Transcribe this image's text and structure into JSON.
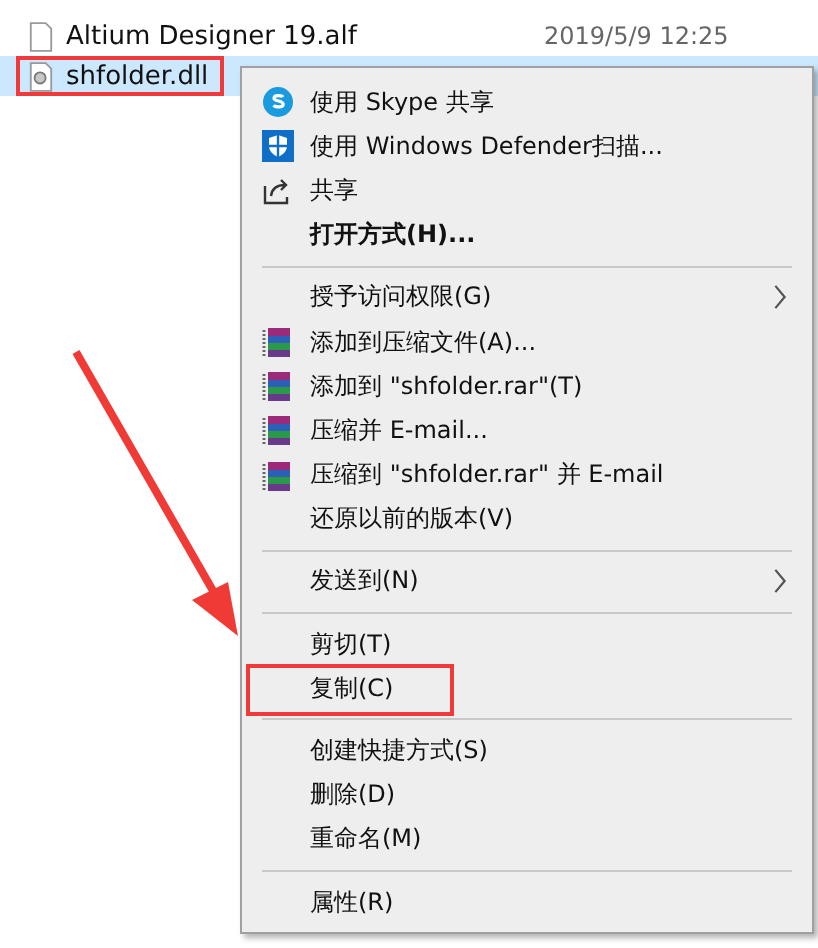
{
  "files": [
    {
      "name": "Altium Designer 19.alf",
      "date": "2019/5/9 12:25",
      "selected": false,
      "outlined": false,
      "kind": "document"
    },
    {
      "name": "shfolder.dll",
      "selected": true,
      "outlined": true,
      "kind": "dll"
    }
  ],
  "context_menu": {
    "items": [
      {
        "kind": "skype",
        "label": "使用 Skype 共享",
        "bold": false,
        "submenu": false,
        "outlined": false
      },
      {
        "kind": "defender",
        "label": "使用 Windows Defender扫描...",
        "bold": false,
        "submenu": false,
        "outlined": false
      },
      {
        "kind": "share",
        "label": "共享",
        "bold": false,
        "submenu": false,
        "outlined": false
      },
      {
        "kind": "plain",
        "label": "打开方式(H)...",
        "bold": true,
        "submenu": false,
        "outlined": false
      },
      {
        "kind": "separator"
      },
      {
        "kind": "plain",
        "label": "授予访问权限(G)",
        "bold": false,
        "submenu": true,
        "outlined": false
      },
      {
        "kind": "archive",
        "label": "添加到压缩文件(A)...",
        "bold": false,
        "submenu": false,
        "outlined": false
      },
      {
        "kind": "archive",
        "label": "添加到 \"shfolder.rar\"(T)",
        "bold": false,
        "submenu": false,
        "outlined": false
      },
      {
        "kind": "archive",
        "label": "压缩并 E-mail...",
        "bold": false,
        "submenu": false,
        "outlined": false
      },
      {
        "kind": "archive",
        "label": "压缩到 \"shfolder.rar\" 并 E-mail",
        "bold": false,
        "submenu": false,
        "outlined": false
      },
      {
        "kind": "plain",
        "label": "还原以前的版本(V)",
        "bold": false,
        "submenu": false,
        "outlined": false
      },
      {
        "kind": "separator"
      },
      {
        "kind": "plain",
        "label": "发送到(N)",
        "bold": false,
        "submenu": true,
        "outlined": false
      },
      {
        "kind": "separator"
      },
      {
        "kind": "plain",
        "label": "剪切(T)",
        "bold": false,
        "submenu": false,
        "outlined": false
      },
      {
        "kind": "plain",
        "label": "复制(C)",
        "bold": false,
        "submenu": false,
        "outlined": true
      },
      {
        "kind": "separator"
      },
      {
        "kind": "plain",
        "label": "创建快捷方式(S)",
        "bold": false,
        "submenu": false,
        "outlined": false
      },
      {
        "kind": "plain",
        "label": "删除(D)",
        "bold": false,
        "submenu": false,
        "outlined": false
      },
      {
        "kind": "plain",
        "label": "重命名(M)",
        "bold": false,
        "submenu": false,
        "outlined": false
      },
      {
        "kind": "separator"
      },
      {
        "kind": "plain",
        "label": "属性(R)",
        "bold": false,
        "submenu": false,
        "outlined": false
      }
    ]
  }
}
